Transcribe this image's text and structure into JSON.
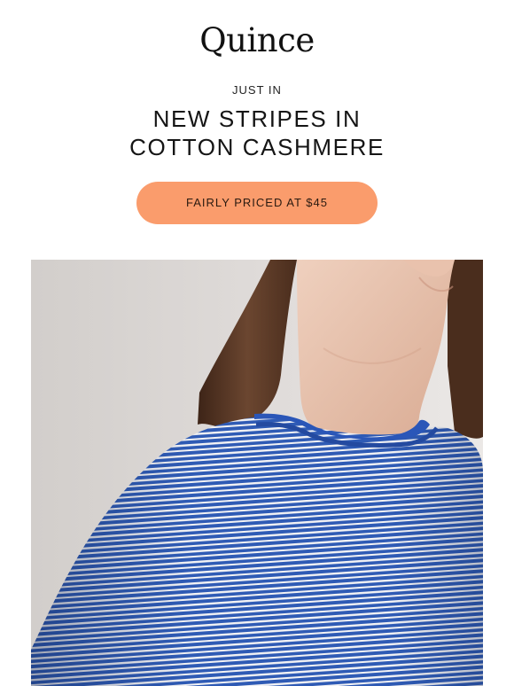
{
  "brand": {
    "logo_text": "Quince"
  },
  "hero_header": {
    "eyebrow": "JUST IN",
    "headline_line1": "NEW STRIPES IN",
    "headline_line2": "COTTON CASHMERE"
  },
  "cta": {
    "label": "FAIRLY PRICED AT $45",
    "color": "#fa9c6c"
  },
  "hero_image": {
    "subject": "woman wearing blue and white striped cotton cashmere sweater",
    "colors": {
      "background": "#dcd8d6",
      "sweater_blue": "#2f5bb5",
      "stripe_white": "#f3f3f5",
      "hair": "#5a3a26",
      "skin": "#e8c4b0"
    }
  }
}
